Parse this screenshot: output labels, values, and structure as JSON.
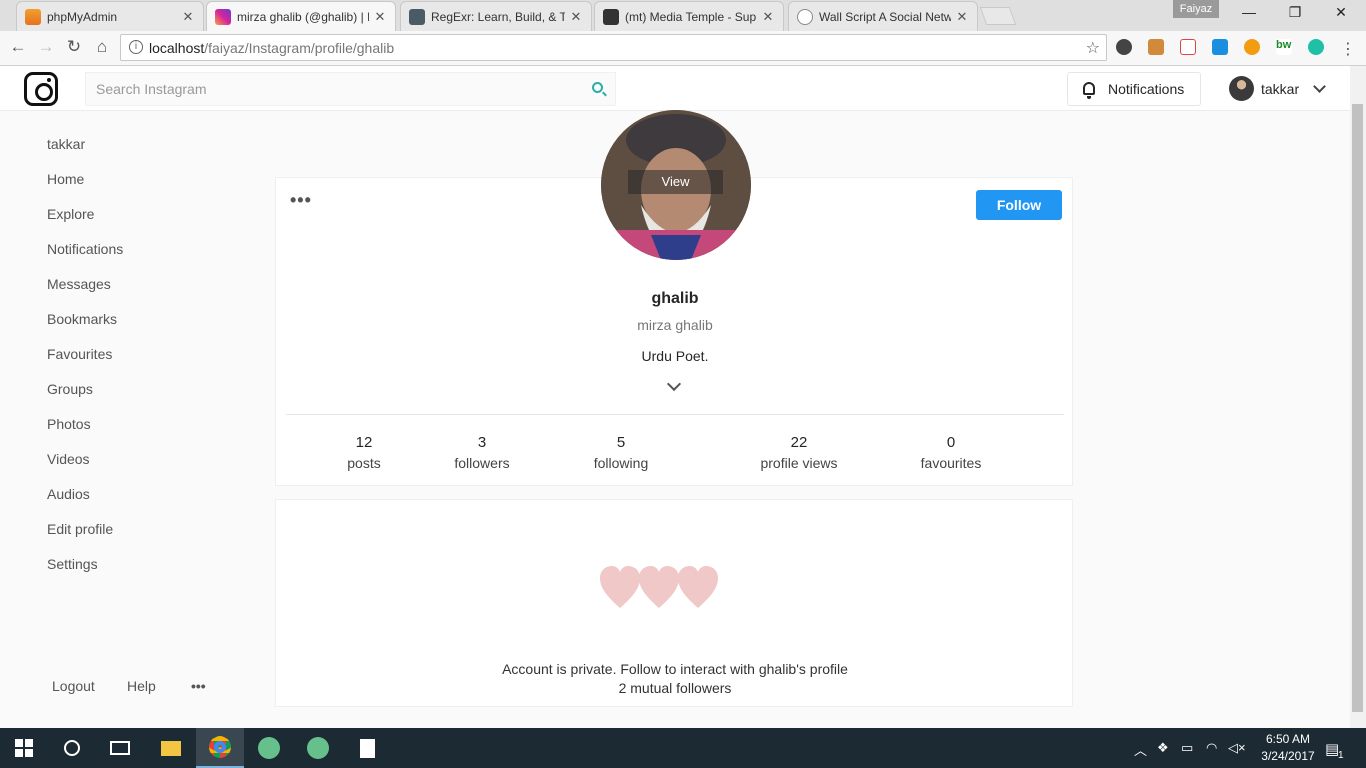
{
  "browser": {
    "tabs": [
      {
        "title": "phpMyAdmin",
        "active": false
      },
      {
        "title": "mirza ghalib (@ghalib) | I",
        "active": true
      },
      {
        "title": "RegExr: Learn, Build, & Te",
        "active": false
      },
      {
        "title": "(mt) Media Temple - Sup",
        "active": false
      },
      {
        "title": "Wall Script A Social Netw",
        "active": false
      }
    ],
    "window_user": "Faiyaz",
    "url_host": "localhost",
    "url_path": "/faiyaz/Instagram/profile/ghalib"
  },
  "topbar": {
    "search_placeholder": "Search Instagram",
    "notifications_label": "Notifications",
    "username": "takkar"
  },
  "sidebar": {
    "items": [
      "takkar",
      "Home",
      "Explore",
      "Notifications",
      "Messages",
      "Bookmarks",
      "Favourites",
      "Groups",
      "Photos",
      "Videos",
      "Audios",
      "Edit profile",
      "Settings"
    ],
    "footer": {
      "logout": "Logout",
      "help": "Help",
      "more": "•••"
    }
  },
  "profile": {
    "more": "•••",
    "follow_label": "Follow",
    "view_label": "View",
    "handle": "ghalib",
    "full_name": "mirza ghalib",
    "bio": "Urdu Poet.",
    "stats": [
      {
        "value": "12",
        "label": "posts"
      },
      {
        "value": "3",
        "label": "followers"
      },
      {
        "value": "5",
        "label": "following"
      },
      {
        "value": "22",
        "label": "profile views"
      },
      {
        "value": "0",
        "label": "favourites"
      }
    ]
  },
  "private_card": {
    "message": "Account is private. Follow to interact with ghalib's profile",
    "mutual": "2 mutual followers",
    "heart_color": "#f0c8c8"
  },
  "taskbar": {
    "time": "6:50 AM",
    "date": "3/24/2017",
    "notification_count": "1"
  },
  "colors": {
    "accent": "#2196f3",
    "search_icon": "#2aaea9"
  }
}
